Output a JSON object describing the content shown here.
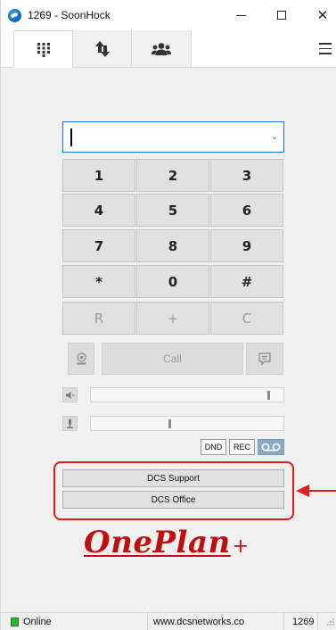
{
  "window": {
    "title": "1269 - SoonHock"
  },
  "tabs": [
    {
      "icon": "keypad-icon"
    },
    {
      "icon": "transfer-arrows-icon"
    },
    {
      "icon": "contacts-icon"
    }
  ],
  "dial_input": {
    "value": "",
    "placeholder": ""
  },
  "keypad": {
    "keys": [
      "1",
      "2",
      "3",
      "4",
      "5",
      "6",
      "7",
      "8",
      "9",
      "*",
      "0",
      "#",
      "R",
      "+",
      "C"
    ]
  },
  "call": {
    "label": "Call"
  },
  "controls": {
    "speaker_level": 0.93,
    "mic_level": 0.41,
    "dnd_label": "DND",
    "rec_label": "REC",
    "voicemail_icon": "voicemail-icon"
  },
  "speed_dial": [
    {
      "label": "DCS Support"
    },
    {
      "label": "DCS Office"
    }
  ],
  "logo": {
    "text": "OnePlan",
    "suffix": "+"
  },
  "status": {
    "state": "Online",
    "website": "www.dcsnetworks.co",
    "extension": "1269"
  },
  "colors": {
    "accent_blue": "#1a73d9",
    "highlight_red": "#e21b1b",
    "logo_red": "#c30d0d",
    "online_green": "#2fb52f"
  }
}
